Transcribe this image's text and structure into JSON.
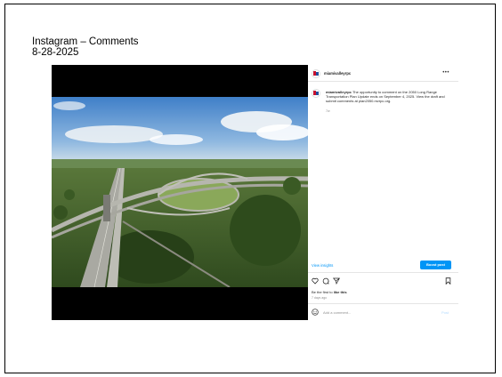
{
  "slide": {
    "title_line1": "Instagram – Comments",
    "title_line2": "8-28-2025"
  },
  "post": {
    "image_desc": "aerial-highway-interchange",
    "header": {
      "username": "miamivalleyrpc"
    },
    "caption": {
      "username": "miamivalleyrpc",
      "text": "The opportunity to comment on the 2050 Long Range Transportation Plan Update ends on September 4, 2025. View the draft and submit comments at plan2050.mvrpc.org.",
      "time": "7w"
    },
    "insights_label": "View insights",
    "boost_label": "Boost post",
    "likes_text": "Be the first to ",
    "likes_link": "like this",
    "time_ago": "7 days ago",
    "comment_placeholder": "Add a comment...",
    "post_label": "Post"
  },
  "colors": {
    "accent": "#0095f6",
    "logo_red": "#c8102e",
    "logo_blue": "#1f4e9c"
  }
}
